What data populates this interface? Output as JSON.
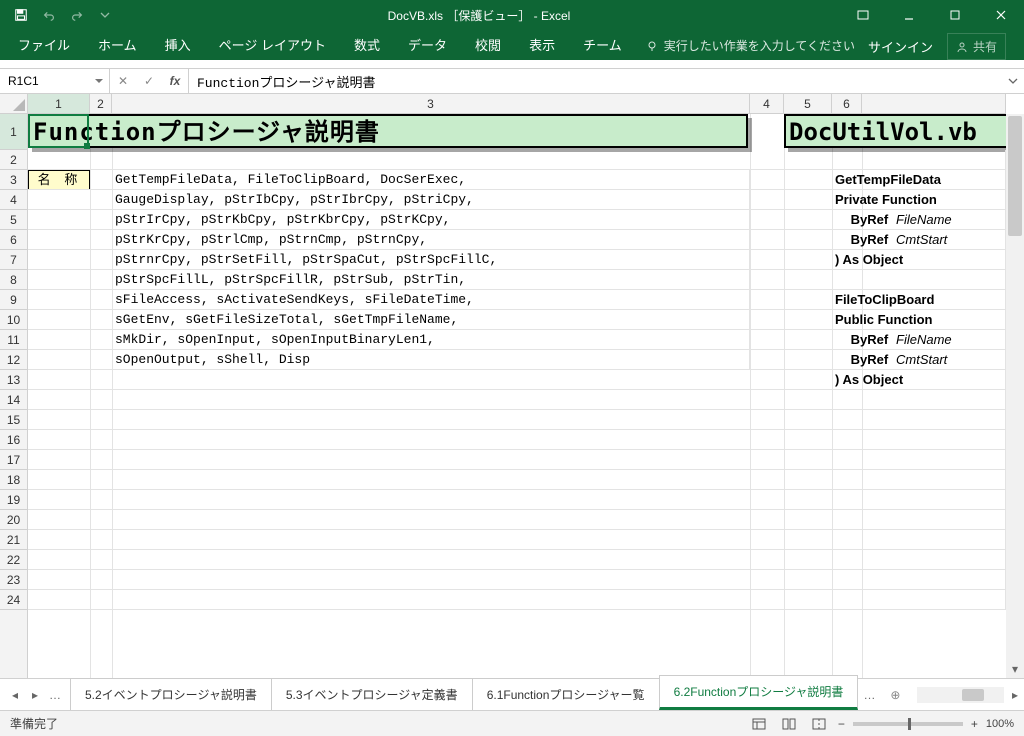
{
  "window": {
    "title": "DocVB.xls ［保護ビュー］ - Excel"
  },
  "qat": {
    "save": "保存",
    "undo": "元に戻す",
    "redo": "やり直し"
  },
  "ribbon": {
    "tabs": [
      "ファイル",
      "ホーム",
      "挿入",
      "ページ レイアウト",
      "数式",
      "データ",
      "校閲",
      "表示",
      "チーム"
    ],
    "tell_me": "実行したい作業を入力してください",
    "signin": "サインイン",
    "share": "共有"
  },
  "fxbar": {
    "namebox": "R1C1",
    "formula": "Functionプロシージャ説明書"
  },
  "columns": {
    "labels": [
      "1",
      "2",
      "3",
      "4",
      "5",
      "6"
    ],
    "widths": [
      62,
      22,
      638,
      34,
      48,
      30
    ]
  },
  "rows": {
    "heights": {
      "r1": 36
    }
  },
  "sheet": {
    "title_main": "Functionプロシージャ説明書",
    "title_right": "DocUtilVol.vb",
    "label_name": "名 称",
    "lines": [
      "GetTempFileData, FileToClipBoard, DocSerExec,",
      "GaugeDisplay, pStrIbCpy, pStrIbrCpy, pStriCpy,",
      "pStrIrCpy, pStrKbCpy, pStrKbrCpy, pStrKCpy,",
      "pStrKrCpy, pStrlCmp, pStrnCmp, pStrnCpy,",
      "pStrnrCpy, pStrSetFill, pStrSpaCut, pStrSpcFillC,",
      "pStrSpcFillL, pStrSpcFillR, pStrSub, pStrTin,",
      "sFileAccess, sActivateSendKeys, sFileDateTime,",
      "sGetEnv, sGetFileSizeTotal, sGetTmpFileName,",
      "sMkDir, sOpenInput, sOpenInputBinaryLen1,",
      "sOpenOutput, sShell, Disp"
    ],
    "right_block": [
      {
        "text": "GetTempFileData",
        "bold": true
      },
      {
        "text": "Private Function",
        "bold": true
      },
      {
        "text": "  ByRef FileName",
        "bold": false,
        "italic": true
      },
      {
        "text": "  ByRef CmtStart",
        "bold": false,
        "italic": true
      },
      {
        "text": ") As Object",
        "bold": true
      },
      {
        "text": "",
        "bold": false
      },
      {
        "text": "FileToClipBoard",
        "bold": true
      },
      {
        "text": "Public Function",
        "bold": true
      },
      {
        "text": "  ByRef FileName",
        "bold": false,
        "italic": true
      },
      {
        "text": "  ByRef CmtStart",
        "bold": false,
        "italic": true
      },
      {
        "text": ") As Object",
        "bold": true
      }
    ]
  },
  "tabs": {
    "items": [
      {
        "label": "5.2イベントプロシージャ説明書",
        "active": false
      },
      {
        "label": "5.3イベントプロシージャ定義書",
        "active": false
      },
      {
        "label": "6.1Functionプロシージャー覧",
        "active": false
      },
      {
        "label": "6.2Functionプロシージャ説明書",
        "active": true
      }
    ]
  },
  "status": {
    "ready": "準備完了",
    "zoom": "100%"
  }
}
